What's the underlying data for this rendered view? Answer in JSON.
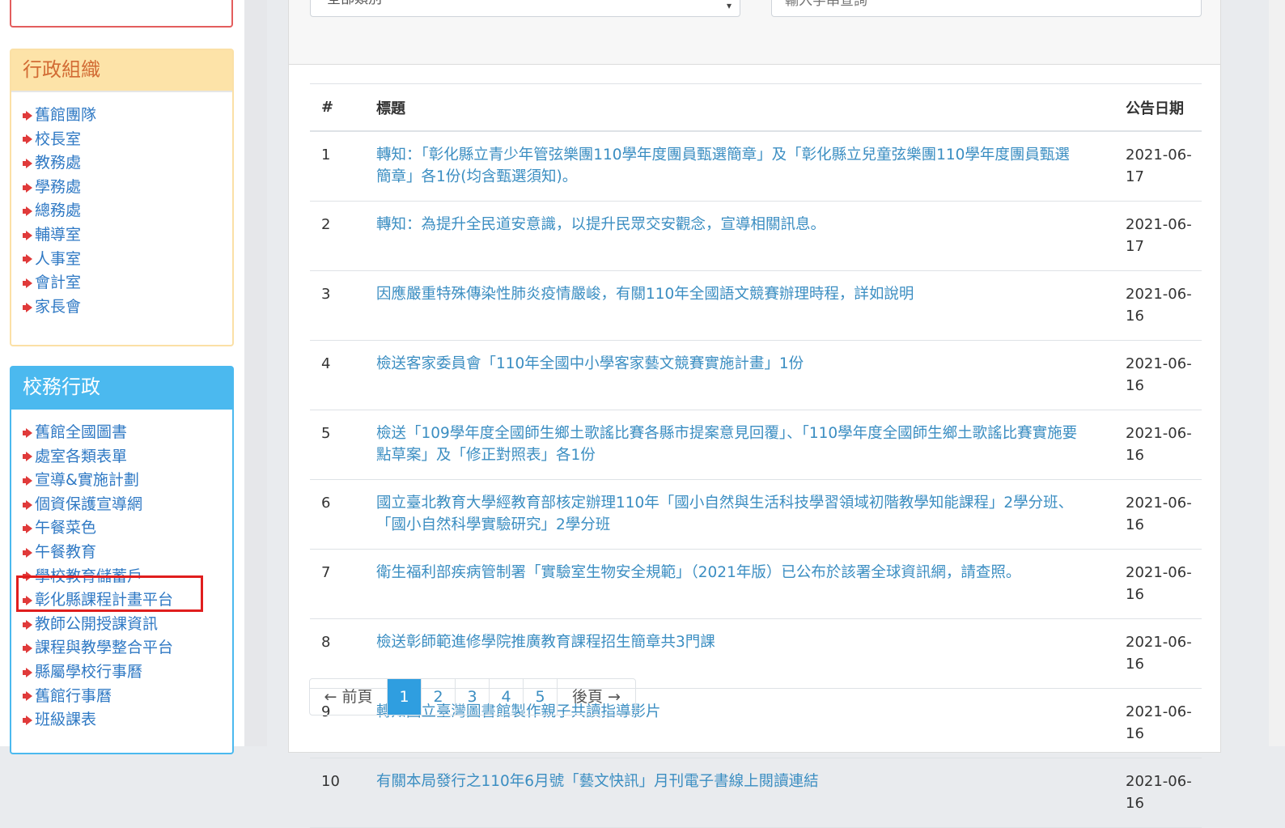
{
  "sidebar": {
    "panels": [
      {
        "title": "行政組織",
        "items": [
          "舊館團隊",
          "校長室",
          "教務處",
          "學務處",
          "總務處",
          "輔導室",
          "人事室",
          "會計室",
          "家長會"
        ]
      },
      {
        "title": "校務行政",
        "items": [
          "舊館全國圖書",
          "處室各類表單",
          "宣導&實施計劃",
          "個資保護宣導網",
          "午餐菜色",
          "午餐教育",
          "學校教育儲蓄戶",
          "彰化縣課程計畫平台",
          "教師公開授課資訊",
          "課程與教學整合平台",
          "縣屬學校行事曆",
          "舊館行事曆",
          "班級課表"
        ]
      }
    ]
  },
  "filters": {
    "category_selected": "全部類別",
    "search_placeholder": "輸入字串查詢"
  },
  "table": {
    "headers": {
      "num": "#",
      "title": "標題",
      "date": "公告日期"
    },
    "rows": [
      {
        "num": "1",
        "title": "轉知：「彰化縣立青少年管弦樂團110學年度團員甄選簡章」及「彰化縣立兒童弦樂團110學年度團員甄選簡章」各1份(均含甄選須知)。",
        "date": "2021-06-17"
      },
      {
        "num": "2",
        "title": "轉知：為提升全民道安意識，以提升民眾交安觀念，宣導相關訊息。",
        "date": "2021-06-17"
      },
      {
        "num": "3",
        "title": "因應嚴重特殊傳染性肺炎疫情嚴峻，有關110年全國語文競賽辦理時程，詳如說明",
        "date": "2021-06-16"
      },
      {
        "num": "4",
        "title": "檢送客家委員會「110年全國中小學客家藝文競賽實施計畫」1份",
        "date": "2021-06-16"
      },
      {
        "num": "5",
        "title": "檢送「109學年度全國師生鄉土歌謠比賽各縣市提案意見回覆」、「110學年度全國師生鄉土歌謠比賽實施要點草案」及「修正對照表」各1份",
        "date": "2021-06-16"
      },
      {
        "num": "6",
        "title": "國立臺北教育大學經教育部核定辦理110年「國小自然與生活科技學習領域初階教學知能課程」2學分班、「國小自然科學實驗研究」2學分班",
        "date": "2021-06-16"
      },
      {
        "num": "7",
        "title": "衛生福利部疾病管制署「實驗室生物安全規範」（2021年版）已公布於該署全球資訊網，請查照。",
        "date": "2021-06-16"
      },
      {
        "num": "8",
        "title": "檢送彰師範進修學院推廣教育課程招生簡章共3門課",
        "date": "2021-06-16"
      },
      {
        "num": "9",
        "title": "轉知國立臺灣圖書館製作親子共讀指導影片",
        "date": "2021-06-16"
      },
      {
        "num": "10",
        "title": "有關本局發行之110年6月號「藝文快訊」月刊電子書線上閱讀連結",
        "date": "2021-06-16"
      }
    ]
  },
  "pagination": {
    "prev": "← 前頁",
    "pages": [
      "1",
      "2",
      "3",
      "4",
      "5"
    ],
    "current": "1",
    "next": "後頁 →"
  },
  "colors": {
    "admin_header_bg": "#fde3a8",
    "admin_header_text": "#d26b34",
    "school_header_bg": "#4bb9ef",
    "link": "#3b8ec2",
    "active_page": "#2f9ee0",
    "highlight": "#e01e1e"
  }
}
